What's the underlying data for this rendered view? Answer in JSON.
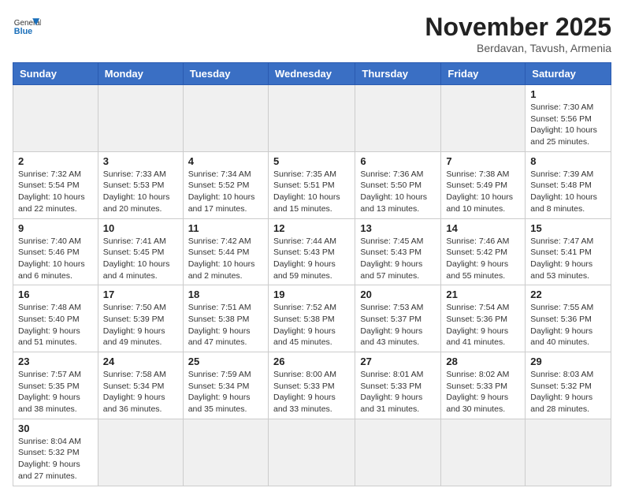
{
  "logo": {
    "general": "General",
    "blue": "Blue"
  },
  "title": "November 2025",
  "subtitle": "Berdavan, Tavush, Armenia",
  "days_of_week": [
    "Sunday",
    "Monday",
    "Tuesday",
    "Wednesday",
    "Thursday",
    "Friday",
    "Saturday"
  ],
  "weeks": [
    [
      {
        "day": "",
        "info": ""
      },
      {
        "day": "",
        "info": ""
      },
      {
        "day": "",
        "info": ""
      },
      {
        "day": "",
        "info": ""
      },
      {
        "day": "",
        "info": ""
      },
      {
        "day": "",
        "info": ""
      },
      {
        "day": "1",
        "info": "Sunrise: 7:30 AM\nSunset: 5:56 PM\nDaylight: 10 hours and 25 minutes."
      }
    ],
    [
      {
        "day": "2",
        "info": "Sunrise: 7:32 AM\nSunset: 5:54 PM\nDaylight: 10 hours and 22 minutes."
      },
      {
        "day": "3",
        "info": "Sunrise: 7:33 AM\nSunset: 5:53 PM\nDaylight: 10 hours and 20 minutes."
      },
      {
        "day": "4",
        "info": "Sunrise: 7:34 AM\nSunset: 5:52 PM\nDaylight: 10 hours and 17 minutes."
      },
      {
        "day": "5",
        "info": "Sunrise: 7:35 AM\nSunset: 5:51 PM\nDaylight: 10 hours and 15 minutes."
      },
      {
        "day": "6",
        "info": "Sunrise: 7:36 AM\nSunset: 5:50 PM\nDaylight: 10 hours and 13 minutes."
      },
      {
        "day": "7",
        "info": "Sunrise: 7:38 AM\nSunset: 5:49 PM\nDaylight: 10 hours and 10 minutes."
      },
      {
        "day": "8",
        "info": "Sunrise: 7:39 AM\nSunset: 5:48 PM\nDaylight: 10 hours and 8 minutes."
      }
    ],
    [
      {
        "day": "9",
        "info": "Sunrise: 7:40 AM\nSunset: 5:46 PM\nDaylight: 10 hours and 6 minutes."
      },
      {
        "day": "10",
        "info": "Sunrise: 7:41 AM\nSunset: 5:45 PM\nDaylight: 10 hours and 4 minutes."
      },
      {
        "day": "11",
        "info": "Sunrise: 7:42 AM\nSunset: 5:44 PM\nDaylight: 10 hours and 2 minutes."
      },
      {
        "day": "12",
        "info": "Sunrise: 7:44 AM\nSunset: 5:43 PM\nDaylight: 9 hours and 59 minutes."
      },
      {
        "day": "13",
        "info": "Sunrise: 7:45 AM\nSunset: 5:43 PM\nDaylight: 9 hours and 57 minutes."
      },
      {
        "day": "14",
        "info": "Sunrise: 7:46 AM\nSunset: 5:42 PM\nDaylight: 9 hours and 55 minutes."
      },
      {
        "day": "15",
        "info": "Sunrise: 7:47 AM\nSunset: 5:41 PM\nDaylight: 9 hours and 53 minutes."
      }
    ],
    [
      {
        "day": "16",
        "info": "Sunrise: 7:48 AM\nSunset: 5:40 PM\nDaylight: 9 hours and 51 minutes."
      },
      {
        "day": "17",
        "info": "Sunrise: 7:50 AM\nSunset: 5:39 PM\nDaylight: 9 hours and 49 minutes."
      },
      {
        "day": "18",
        "info": "Sunrise: 7:51 AM\nSunset: 5:38 PM\nDaylight: 9 hours and 47 minutes."
      },
      {
        "day": "19",
        "info": "Sunrise: 7:52 AM\nSunset: 5:38 PM\nDaylight: 9 hours and 45 minutes."
      },
      {
        "day": "20",
        "info": "Sunrise: 7:53 AM\nSunset: 5:37 PM\nDaylight: 9 hours and 43 minutes."
      },
      {
        "day": "21",
        "info": "Sunrise: 7:54 AM\nSunset: 5:36 PM\nDaylight: 9 hours and 41 minutes."
      },
      {
        "day": "22",
        "info": "Sunrise: 7:55 AM\nSunset: 5:36 PM\nDaylight: 9 hours and 40 minutes."
      }
    ],
    [
      {
        "day": "23",
        "info": "Sunrise: 7:57 AM\nSunset: 5:35 PM\nDaylight: 9 hours and 38 minutes."
      },
      {
        "day": "24",
        "info": "Sunrise: 7:58 AM\nSunset: 5:34 PM\nDaylight: 9 hours and 36 minutes."
      },
      {
        "day": "25",
        "info": "Sunrise: 7:59 AM\nSunset: 5:34 PM\nDaylight: 9 hours and 35 minutes."
      },
      {
        "day": "26",
        "info": "Sunrise: 8:00 AM\nSunset: 5:33 PM\nDaylight: 9 hours and 33 minutes."
      },
      {
        "day": "27",
        "info": "Sunrise: 8:01 AM\nSunset: 5:33 PM\nDaylight: 9 hours and 31 minutes."
      },
      {
        "day": "28",
        "info": "Sunrise: 8:02 AM\nSunset: 5:33 PM\nDaylight: 9 hours and 30 minutes."
      },
      {
        "day": "29",
        "info": "Sunrise: 8:03 AM\nSunset: 5:32 PM\nDaylight: 9 hours and 28 minutes."
      }
    ],
    [
      {
        "day": "30",
        "info": "Sunrise: 8:04 AM\nSunset: 5:32 PM\nDaylight: 9 hours and 27 minutes."
      },
      {
        "day": "",
        "info": ""
      },
      {
        "day": "",
        "info": ""
      },
      {
        "day": "",
        "info": ""
      },
      {
        "day": "",
        "info": ""
      },
      {
        "day": "",
        "info": ""
      },
      {
        "day": "",
        "info": ""
      }
    ]
  ]
}
